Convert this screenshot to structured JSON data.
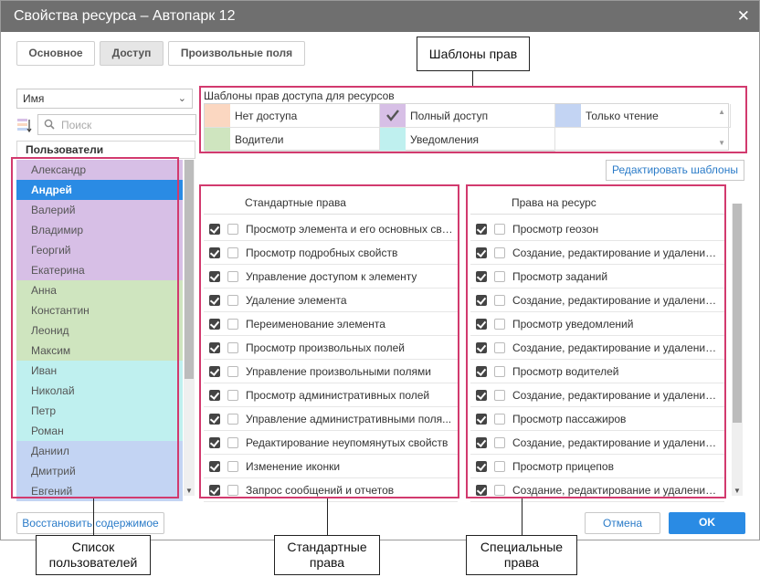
{
  "dialog": {
    "title": "Свойства ресурса – Автопарк 12",
    "close": "✕"
  },
  "tabs": [
    {
      "label": "Основное"
    },
    {
      "label": "Доступ"
    },
    {
      "label": "Произвольные поля"
    }
  ],
  "users": {
    "select_value": "Имя",
    "search_placeholder": "Поиск",
    "header": "Пользователи",
    "items": [
      {
        "name": "Александр",
        "color": "#d7bfe6"
      },
      {
        "name": "Андрей",
        "color": "#2a8be4"
      },
      {
        "name": "Валерий",
        "color": "#d7bfe6"
      },
      {
        "name": "Владимир",
        "color": "#d7bfe6"
      },
      {
        "name": "Георгий",
        "color": "#d7bfe6"
      },
      {
        "name": "Екатерина",
        "color": "#d7bfe6"
      },
      {
        "name": "Анна",
        "color": "#cfe5bf"
      },
      {
        "name": "Константин",
        "color": "#cfe5bf"
      },
      {
        "name": "Леонид",
        "color": "#cfe5bf"
      },
      {
        "name": "Максим",
        "color": "#cfe5bf"
      },
      {
        "name": "Иван",
        "color": "#bff0ef"
      },
      {
        "name": "Николай",
        "color": "#bff0ef"
      },
      {
        "name": "Петр",
        "color": "#bff0ef"
      },
      {
        "name": "Роман",
        "color": "#bff0ef"
      },
      {
        "name": "Даниил",
        "color": "#c3d4f3"
      },
      {
        "name": "Дмитрий",
        "color": "#c3d4f3"
      },
      {
        "name": "Евгений",
        "color": "#c3d4f3"
      }
    ]
  },
  "templates": {
    "label": "Шаблоны прав доступа для ресурсов",
    "items": [
      {
        "name": "Нет доступа",
        "color": "#fbd7c1"
      },
      {
        "name": "Полный доступ",
        "color": "#d7bfe6"
      },
      {
        "name": "Только чтение",
        "color": "#c3d4f3"
      },
      {
        "name": "Водители",
        "color": "#cfe5bf"
      },
      {
        "name": "Уведомления",
        "color": "#bff0ef"
      }
    ],
    "edit_button": "Редактировать шаблоны"
  },
  "standard_rights": {
    "header": "Стандартные права",
    "items": [
      "Просмотр элемента и его основных сво...",
      "Просмотр подробных свойств",
      "Управление доступом к элементу",
      "Удаление элемента",
      "Переименование элемента",
      "Просмотр произвольных полей",
      "Управление произвольными полями",
      "Просмотр административных полей",
      "Управление административными поля...",
      "Редактирование неупомянутых свойств",
      "Изменение иконки",
      "Запрос сообщений и отчетов"
    ]
  },
  "resource_rights": {
    "header": "Права на ресурс",
    "items": [
      "Просмотр геозон",
      "Создание, редактирование и удаление ...",
      "Просмотр заданий",
      "Создание, редактирование и удаление ...",
      "Просмотр уведомлений",
      "Создание, редактирование и удаление ...",
      "Просмотр водителей",
      "Создание, редактирование и удаление ...",
      "Просмотр пассажиров",
      "Создание, редактирование и удаление ...",
      "Просмотр прицепов",
      "Создание, редактирование и удаление ..."
    ]
  },
  "footer": {
    "restore": "Восстановить содержимое",
    "cancel": "Отмена",
    "ok": "OK"
  },
  "annotations": {
    "templates": "Шаблоны прав",
    "users_line1": "Список",
    "users_line2": "пользователей",
    "standard_line1": "Стандартные",
    "standard_line2": "права",
    "special_line1": "Специальные",
    "special_line2": "права"
  },
  "colors": {
    "highlight": "#d23a6e",
    "selection": "#2a8be4",
    "titlebar": "#6f6f6f"
  }
}
